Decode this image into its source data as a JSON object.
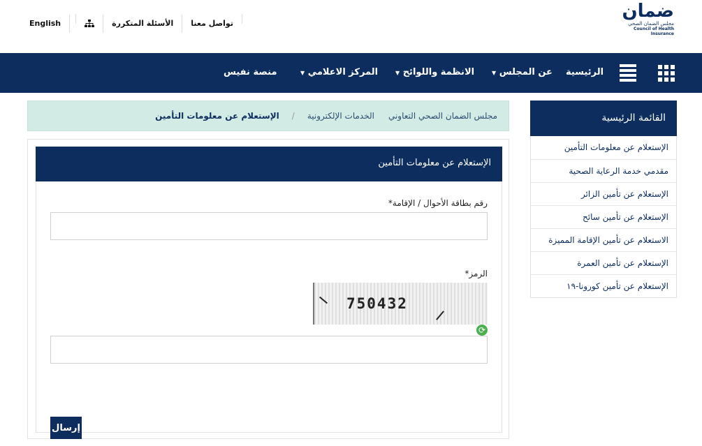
{
  "logo": {
    "ar": "ضمان",
    "sub_ar": "مجلس الضمان الصحي",
    "sub_en": "Council of Health Insurance"
  },
  "toplinks": {
    "contact": "تواصل معنا",
    "faq": "الأسئلة المتكررة",
    "sitemap_icon": "sitemap-icon",
    "language": "English"
  },
  "nav": {
    "items": [
      {
        "label": "الرئيسية"
      },
      {
        "label": "عن المجلس"
      },
      {
        "label": "الانظمة واللوائح"
      },
      {
        "label": "المركز الاعلامي"
      },
      {
        "label": "منصة نفيس"
      }
    ]
  },
  "breadcrumb": {
    "home": "مجلس الضمان الصحي التعاوني",
    "section": "الخدمات الإلكترونية",
    "separator": "/",
    "current": "الإستعلام عن معلومات التأمين"
  },
  "sidebar": {
    "title": "القائمة الرئيسية",
    "items": [
      {
        "label": "الإستعلام عن معلومات التأمين"
      },
      {
        "label": "مقدمي خدمة الرعاية الصحية"
      },
      {
        "label": "الإستعلام عن تأمين الزائر"
      },
      {
        "label": "الإستعلام عن تأمين سائح"
      },
      {
        "label": "الاستعلام عن تأمين الإقامة المميزة"
      },
      {
        "label": "الإستعلام عن تأمين العمرة"
      },
      {
        "label": "الإستعلام عن تأمين كورونا-١٩"
      }
    ]
  },
  "form": {
    "title": "الإستعلام عن معلومات التأمين",
    "id_label": "رقم بطاقة الأحوال / الإقامة*",
    "id_value": "",
    "captcha_label": "الرمز*",
    "captcha_code": "750432",
    "captcha_value": "",
    "submit_label": "إرسال"
  },
  "colors": {
    "primary": "#0d2d5e",
    "accent": "#1fb5a8",
    "breadcrumb_bg": "#d2ebe5"
  }
}
